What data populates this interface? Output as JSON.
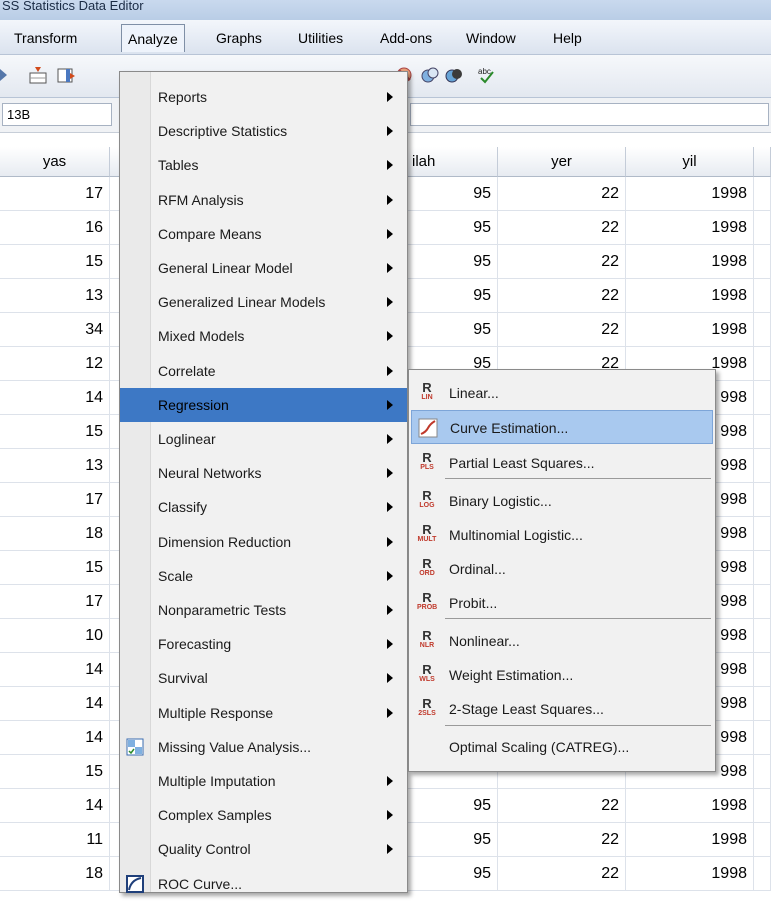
{
  "window": {
    "title": "SS Statistics Data Editor"
  },
  "menubar": {
    "items": [
      {
        "label": "Transform"
      },
      {
        "label": "Analyze"
      },
      {
        "label": "Graphs"
      },
      {
        "label": "Utilities"
      },
      {
        "label": "Add-ons"
      },
      {
        "label": "Window"
      },
      {
        "label": "Help"
      }
    ]
  },
  "cellbar": {
    "reference": "13B"
  },
  "grid": {
    "columns": [
      "yas",
      "ilah",
      "yer",
      "yil"
    ],
    "rows": [
      {
        "yas": "17",
        "ilah": "95",
        "yer": "22",
        "yil": "1998"
      },
      {
        "yas": "16",
        "ilah": "95",
        "yer": "22",
        "yil": "1998"
      },
      {
        "yas": "15",
        "ilah": "95",
        "yer": "22",
        "yil": "1998"
      },
      {
        "yas": "13",
        "ilah": "95",
        "yer": "22",
        "yil": "1998"
      },
      {
        "yas": "34",
        "ilah": "95",
        "yer": "22",
        "yil": "1998"
      },
      {
        "yas": "12",
        "ilah": "95",
        "yer": "22",
        "yil": "1998"
      },
      {
        "yas": "14",
        "ilah": "",
        "yer": "",
        "yil": "998"
      },
      {
        "yas": "15",
        "ilah": "",
        "yer": "",
        "yil": "998"
      },
      {
        "yas": "13",
        "ilah": "",
        "yer": "",
        "yil": "998"
      },
      {
        "yas": "17",
        "ilah": "",
        "yer": "",
        "yil": "998"
      },
      {
        "yas": "18",
        "ilah": "",
        "yer": "",
        "yil": "998"
      },
      {
        "yas": "15",
        "ilah": "",
        "yer": "",
        "yil": "998"
      },
      {
        "yas": "17",
        "ilah": "",
        "yer": "",
        "yil": "998"
      },
      {
        "yas": "10",
        "ilah": "",
        "yer": "",
        "yil": "998"
      },
      {
        "yas": "14",
        "ilah": "",
        "yer": "",
        "yil": "998"
      },
      {
        "yas": "14",
        "ilah": "",
        "yer": "",
        "yil": "998"
      },
      {
        "yas": "14",
        "ilah": "",
        "yer": "",
        "yil": "998"
      },
      {
        "yas": "15",
        "ilah": "",
        "yer": "",
        "yil": "998"
      },
      {
        "yas": "14",
        "ilah": "95",
        "yer": "22",
        "yil": "1998"
      },
      {
        "yas": "11",
        "ilah": "95",
        "yer": "22",
        "yil": "1998"
      },
      {
        "yas": "18",
        "ilah": "95",
        "yer": "22",
        "yil": "1998"
      }
    ]
  },
  "analyze_menu": {
    "items": [
      {
        "label": "Reports",
        "submenu": true
      },
      {
        "label": "Descriptive Statistics",
        "submenu": true
      },
      {
        "label": "Tables",
        "submenu": true
      },
      {
        "label": "RFM Analysis",
        "submenu": true
      },
      {
        "label": "Compare Means",
        "submenu": true
      },
      {
        "label": "General Linear Model",
        "submenu": true
      },
      {
        "label": "Generalized Linear Models",
        "submenu": true
      },
      {
        "label": "Mixed Models",
        "submenu": true
      },
      {
        "label": "Correlate",
        "submenu": true
      },
      {
        "label": "Regression",
        "submenu": true,
        "highlighted": true
      },
      {
        "label": "Loglinear",
        "submenu": true
      },
      {
        "label": "Neural Networks",
        "submenu": true
      },
      {
        "label": "Classify",
        "submenu": true
      },
      {
        "label": "Dimension Reduction",
        "submenu": true
      },
      {
        "label": "Scale",
        "submenu": true
      },
      {
        "label": "Nonparametric Tests",
        "submenu": true
      },
      {
        "label": "Forecasting",
        "submenu": true
      },
      {
        "label": "Survival",
        "submenu": true
      },
      {
        "label": "Multiple Response",
        "submenu": true
      },
      {
        "label": "Missing Value Analysis...",
        "submenu": false,
        "icon": "missing-value-icon"
      },
      {
        "label": "Multiple Imputation",
        "submenu": true
      },
      {
        "label": "Complex Samples",
        "submenu": true
      },
      {
        "label": "Quality Control",
        "submenu": true
      },
      {
        "label": "ROC Curve...",
        "submenu": false,
        "icon": "roc-curve-icon"
      }
    ]
  },
  "regression_submenu": {
    "items": [
      {
        "label": "Linear...",
        "tag": "LIN"
      },
      {
        "label": "Curve Estimation...",
        "tag": "curve",
        "highlighted": true
      },
      {
        "label": "Partial Least Squares...",
        "tag": "PLS"
      },
      {
        "label": "Binary Logistic...",
        "tag": "LOG"
      },
      {
        "label": "Multinomial Logistic...",
        "tag": "MULT"
      },
      {
        "label": "Ordinal...",
        "tag": "ORD"
      },
      {
        "label": "Probit...",
        "tag": "PROB"
      },
      {
        "label": "Nonlinear...",
        "tag": "NLR"
      },
      {
        "label": "Weight Estimation...",
        "tag": "WLS"
      },
      {
        "label": "2-Stage Least Squares...",
        "tag": "2SLS"
      },
      {
        "label": "Optimal Scaling (CATREG)...",
        "tag": ""
      }
    ]
  }
}
